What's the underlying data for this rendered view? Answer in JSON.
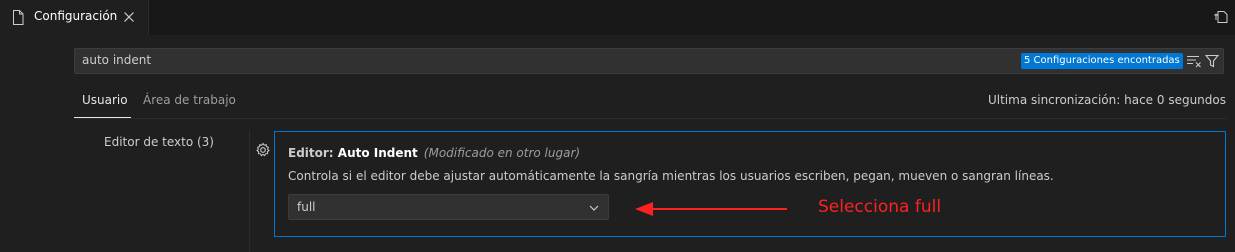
{
  "tab": {
    "title": "Configuración",
    "file_icon": "file-icon",
    "close_icon": "close-icon",
    "open_json_icon": "open-settings-json-icon"
  },
  "search": {
    "value": "auto indent",
    "results_badge": "5 Configuraciones encontradas",
    "clear_icon": "clear-filter-icon",
    "filter_icon": "filter-icon"
  },
  "scopes": {
    "tabs": [
      {
        "label": "Usuario",
        "active": true
      },
      {
        "label": "Área de trabajo",
        "active": false
      }
    ],
    "sync_status": "Ultima sincronización: hace 0 segundos"
  },
  "toc": {
    "items": [
      {
        "label": "Editor de texto (3)"
      }
    ]
  },
  "setting": {
    "category": "Editor: ",
    "name": "Auto Indent",
    "modified_note": "(Modificado en otro lugar)",
    "description": "Controla si el editor debe ajustar automáticamente la sangría mientras los usuarios escriben, pegan, mueven o sangran líneas.",
    "selected_value": "full",
    "gear_icon": "gear-icon"
  },
  "annotation": {
    "text": "Selecciona full",
    "color": "#ff2020"
  },
  "colors": {
    "accent": "#0078d4",
    "background": "#1f1f1f",
    "tabbar": "#181818"
  }
}
